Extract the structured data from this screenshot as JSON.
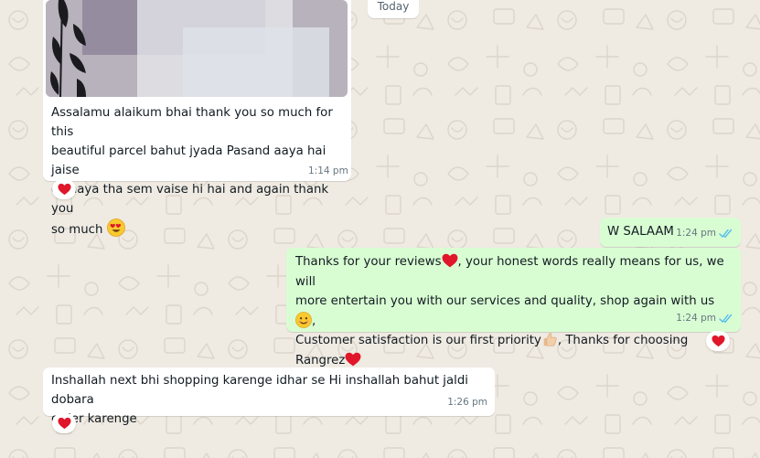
{
  "chat": {
    "date_separator": "Today",
    "messages": [
      {
        "direction": "incoming",
        "text": "Assalamu alaikum bhai thank you so much for this beautiful parcel bahut jyada Pasand aaya hai jaise dikhaya tha sem vaise hi hai and again thank you so much",
        "line1": "Assalamu alaikum bhai thank you so much for this",
        "line2": "beautiful parcel bahut jyada Pasand aaya hai jaise",
        "line3": "dikhaya tha sem vaise hi hai and again thank you",
        "line4": "so much",
        "trailing_emoji": "heart-eyes-emoji",
        "time": "1:14 pm",
        "has_photo": true,
        "reaction": "red-heart"
      },
      {
        "direction": "outgoing",
        "text": "W SALAAM",
        "time": "1:24 pm",
        "status": "read"
      },
      {
        "direction": "outgoing",
        "line1a": "Thanks for your reviews",
        "line1b": ", your honest words really means for us, we will",
        "line2a": "more entertain you with our services and quality, shop again with us",
        "line2b": ",",
        "line3a": "Customer satisfaction is our first priority",
        "line3b": ", Thanks for choosing Rangrez",
        "time": "1:24 pm",
        "status": "read",
        "reaction": "red-heart"
      },
      {
        "direction": "incoming",
        "line1": "Inshallah next bhi shopping karenge idhar se Hi inshallah bahut jaldi dobara",
        "line2": "order karenge",
        "time": "1:26 pm",
        "reaction": "red-heart"
      }
    ]
  },
  "colors": {
    "wallpaper": "#efeae2",
    "incoming_bubble": "#ffffff",
    "outgoing_bubble": "#d9fdd3",
    "read_ticks": "#53bdeb",
    "heart": "#e0162b"
  }
}
